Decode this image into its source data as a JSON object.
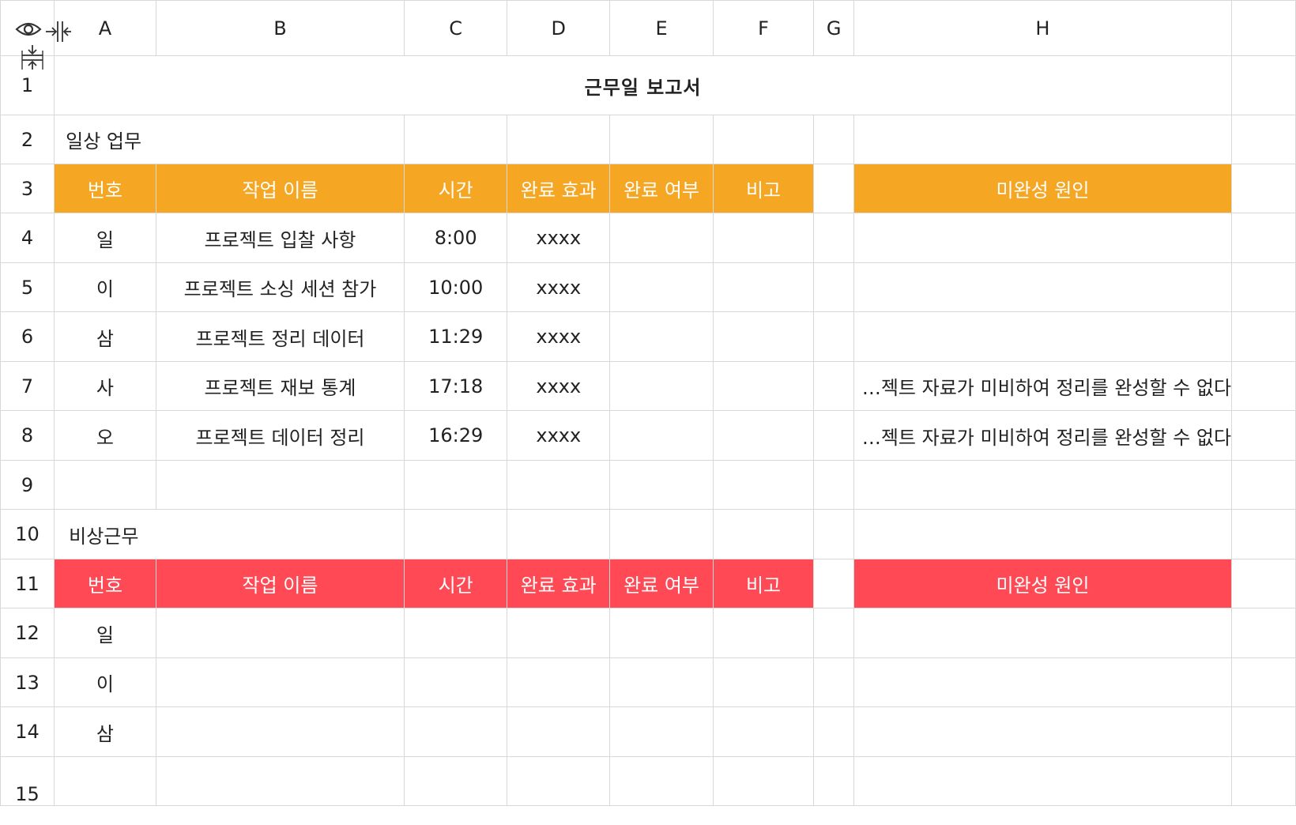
{
  "columns": [
    "A",
    "B",
    "C",
    "D",
    "E",
    "F",
    "G",
    "H"
  ],
  "row_numbers": [
    "1",
    "2",
    "3",
    "4",
    "5",
    "6",
    "7",
    "8",
    "9",
    "10",
    "11",
    "12",
    "13",
    "14",
    "15"
  ],
  "title": "근무일 보고서",
  "daily": {
    "section_label": "일상 업무",
    "headers": {
      "number": "번호",
      "task_name": "작업 이름",
      "time": "시간",
      "effect": "완료 효과",
      "status": "완료 여부",
      "note": "비고",
      "reason": "미완성 원인"
    },
    "rows": [
      {
        "number": "일",
        "task_name": "프로젝트 입찰 사항",
        "time": "8:00",
        "effect": "xxxx",
        "reason": ""
      },
      {
        "number": "이",
        "task_name": "프로젝트 소싱 세션 참가",
        "time": "10:00",
        "effect": "xxxx",
        "reason": ""
      },
      {
        "number": "삼",
        "task_name": "프로젝트 정리 데이터",
        "time": "11:29",
        "effect": "xxxx",
        "reason": ""
      },
      {
        "number": "사",
        "task_name": "프로젝트 재보 통계",
        "time": "17:18",
        "effect": "xxxx",
        "reason": "…젝트 자료가 미비하여 정리를 완성할 수 없다"
      },
      {
        "number": "오",
        "task_name": "프로젝트 데이터 정리",
        "time": "16:29",
        "effect": "xxxx",
        "reason": "…젝트 자료가 미비하여 정리를 완성할 수 없다"
      }
    ]
  },
  "emergency": {
    "section_label": "비상근무",
    "headers": {
      "number": "번호",
      "task_name": "작업 이름",
      "time": "시간",
      "effect": "완료 효과",
      "status": "완료 여부",
      "note": "비고",
      "reason": "미완성 원인"
    },
    "rows": [
      {
        "number": "일"
      },
      {
        "number": "이"
      },
      {
        "number": "삼"
      }
    ]
  },
  "colors": {
    "daily_accent": "#f5a623",
    "emergency_accent": "#ff4a55",
    "grid_line": "#d8d8d8"
  },
  "icons": [
    "eye-icon",
    "collapse-columns-icon",
    "collapse-rows-icon"
  ]
}
